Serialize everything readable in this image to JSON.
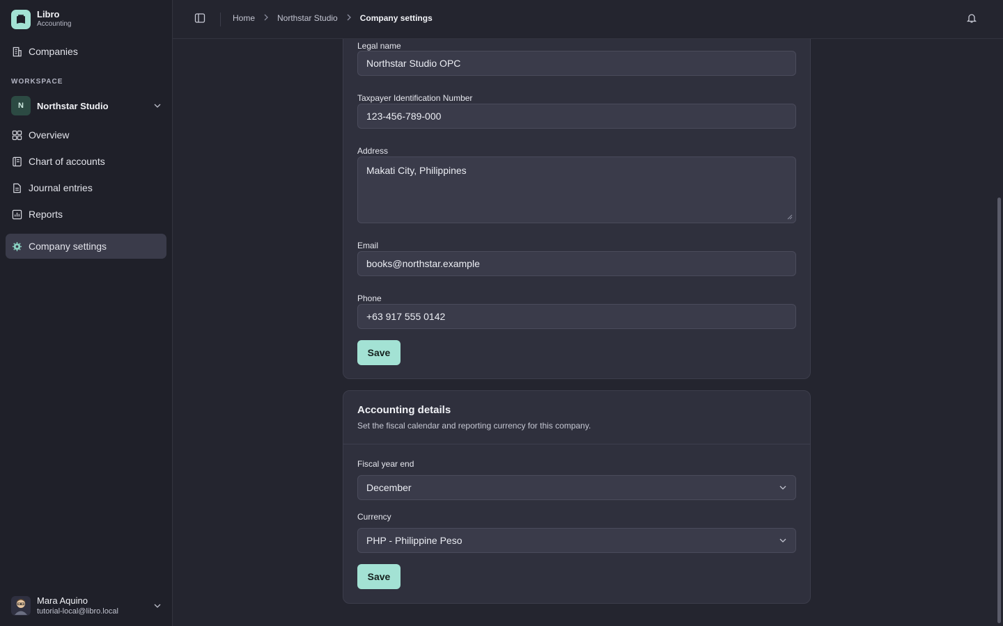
{
  "app": {
    "name": "Libro",
    "subtitle": "Accounting"
  },
  "sidebar": {
    "companies_label": "Companies",
    "section_label": "WORKSPACE",
    "workspace": {
      "initial": "N",
      "name": "Northstar Studio"
    },
    "items": [
      {
        "label": "Overview",
        "icon": "grid-icon"
      },
      {
        "label": "Chart of accounts",
        "icon": "ledger-icon"
      },
      {
        "label": "Journal entries",
        "icon": "file-text-icon"
      },
      {
        "label": "Reports",
        "icon": "bar-chart-icon"
      },
      {
        "label": "Company settings",
        "icon": "gear-icon",
        "active": true
      }
    ],
    "user": {
      "name": "Mara Aquino",
      "email": "tutorial-local@libro.local"
    }
  },
  "topbar": {
    "breadcrumb": [
      "Home",
      "Northstar Studio",
      "Company settings"
    ]
  },
  "company_form": {
    "legal_name_label": "Legal name",
    "legal_name_value": "Northstar Studio OPC",
    "tin_label": "Taxpayer Identification Number",
    "tin_value": "123-456-789-000",
    "address_label": "Address",
    "address_value": "Makati City, Philippines",
    "email_label": "Email",
    "email_value": "books@northstar.example",
    "phone_label": "Phone",
    "phone_value": "+63 917 555 0142",
    "save_label": "Save"
  },
  "accounting_details": {
    "title": "Accounting details",
    "description": "Set the fiscal calendar and reporting currency for this company.",
    "fiscal_label": "Fiscal year end",
    "fiscal_value": "December",
    "currency_label": "Currency",
    "currency_value": "PHP - Philippine Peso",
    "save_label": "Save"
  },
  "colors": {
    "accent": "#a3e2d4",
    "background": "#24252f",
    "sidebar": "#1f2029",
    "card": "#2f303d"
  }
}
